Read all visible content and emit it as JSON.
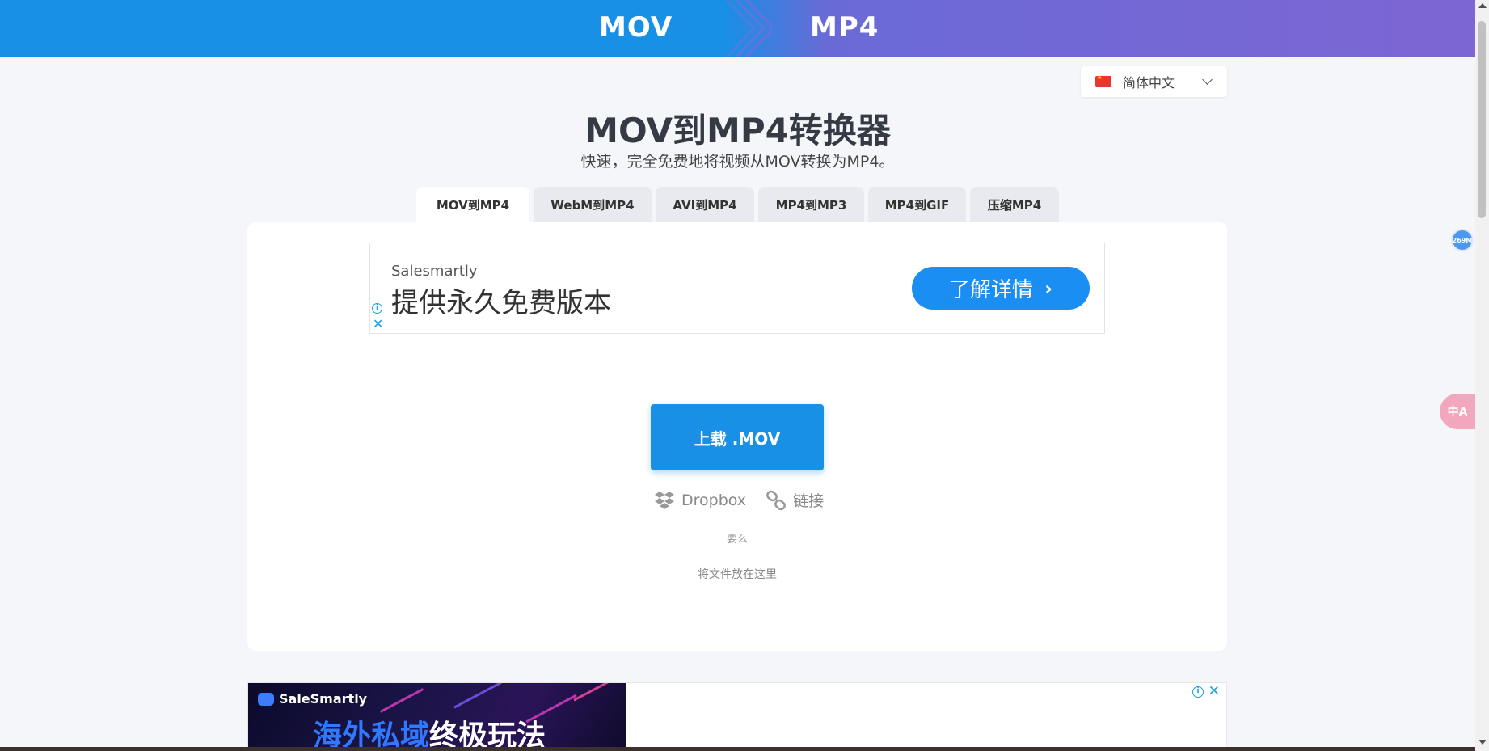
{
  "banner": {
    "from": "MOV",
    "to": "MP4"
  },
  "language": {
    "selected": "简体中文"
  },
  "page": {
    "title": "MOV到MP4转换器",
    "subtitle": "快速，完全免费地将视频从MOV转换为MP4。"
  },
  "tabs": [
    {
      "label": "MOV到MP4",
      "active": true
    },
    {
      "label": "WebM到MP4",
      "active": false
    },
    {
      "label": "AVI到MP4",
      "active": false
    },
    {
      "label": "MP4到MP3",
      "active": false
    },
    {
      "label": "MP4到GIF",
      "active": false
    },
    {
      "label": "压缩MP4",
      "active": false
    }
  ],
  "ad": {
    "brand": "Salesmartly",
    "headline": "提供永久免费版本",
    "cta": "了解详情"
  },
  "upload": {
    "button": "上载 .MOV",
    "dropbox": "Dropbox",
    "link": "链接",
    "or": "要么",
    "drop": "将文件放在这里"
  },
  "ad2": {
    "brand": "SaleSmartly",
    "headline_blue": "海外私域",
    "headline_white": "终极玩法"
  },
  "widgets": {
    "memory": "269M",
    "translate": "中A"
  },
  "colors": {
    "primary": "#1790e6",
    "accent_purple": "#7d66d3",
    "ad_button": "#1a8ef2"
  }
}
